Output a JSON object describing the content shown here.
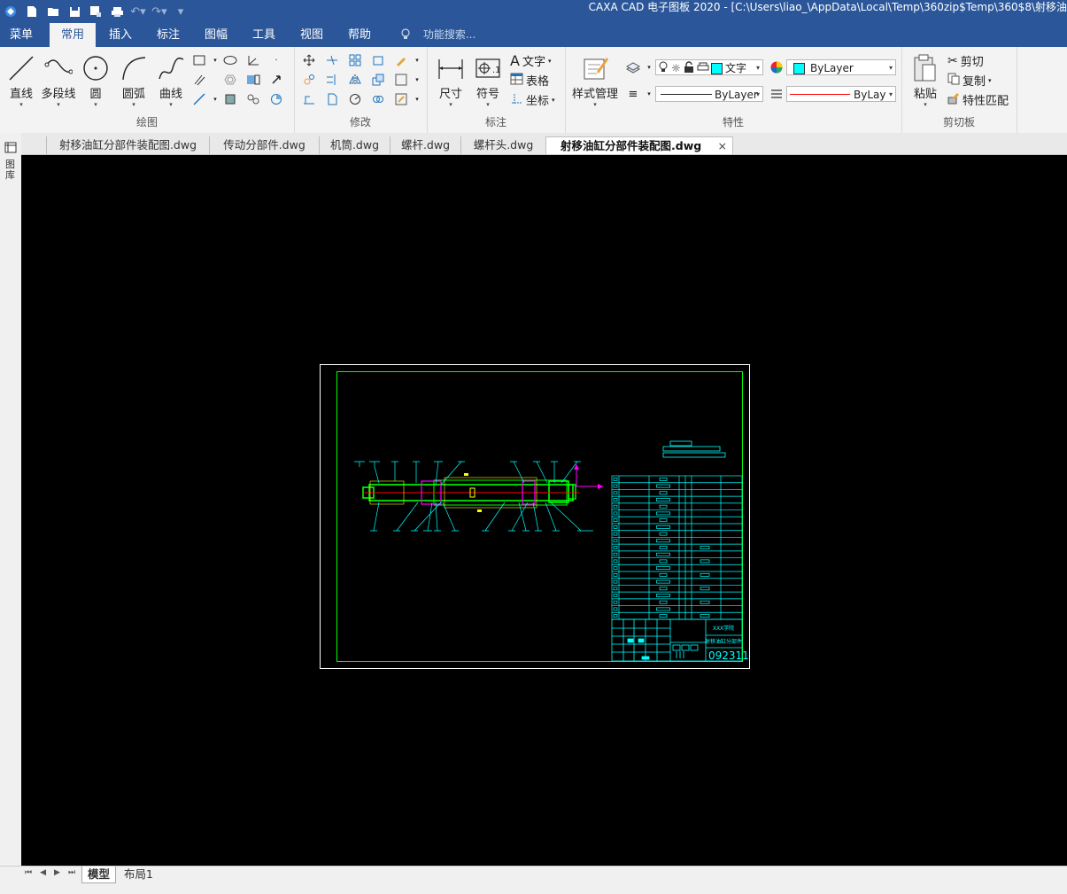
{
  "window": {
    "title": "CAXA CAD 电子图板 2020 - [C:\\Users\\liao_\\AppData\\Local\\Temp\\360zip$Temp\\360$8\\射移油"
  },
  "menu_tabs": [
    "菜单",
    "常用",
    "插入",
    "标注",
    "图幅",
    "工具",
    "视图",
    "帮助"
  ],
  "active_menu_tab": "常用",
  "search_placeholder": "功能搜索...",
  "ribbon": {
    "draw": {
      "label": "绘图",
      "big": [
        "直线",
        "多段线",
        "圆",
        "圆弧",
        "曲线"
      ]
    },
    "modify": {
      "label": "修改"
    },
    "annotate": {
      "label": "标注",
      "big": [
        "尺寸",
        "符号"
      ],
      "small": [
        "文字",
        "表格",
        "坐标"
      ]
    },
    "style": {
      "big": "样式管理"
    },
    "properties": {
      "label": "特性",
      "layer_value": "文字",
      "color_value": "ByLayer",
      "linetype_value": "ByLayer",
      "lineweight_value": "ByLaye",
      "accent_cyan": "#00ffff",
      "accent_red": "#ff0000"
    },
    "clipboard": {
      "label": "剪切板",
      "big": "粘贴",
      "small": [
        "剪切",
        "复制",
        "特性匹配"
      ]
    }
  },
  "doc_tabs": [
    "射移油缸分部件装配图.dwg",
    "传动分部件.dwg",
    "机筒.dwg",
    "螺杆.dwg",
    "螺杆头.dwg",
    "射移油缸分部件装配图.dwg"
  ],
  "active_doc_tab_index": 5,
  "left_strip_label": "图库",
  "layout_tabs": [
    "模型",
    "布局1"
  ],
  "active_layout_tab": "模型",
  "drawing": {
    "title_block_text_1": "XXX学院",
    "title_block_text_2": "射移油缸分部件",
    "drawing_number": "092311",
    "colors": {
      "frame": "#ffffff",
      "border": "#00ff00",
      "lines": "#00ffff",
      "parts": "#00ff00",
      "highlight": "#ff00ff",
      "center": "#ff0000",
      "yellow": "#ffff00"
    }
  }
}
